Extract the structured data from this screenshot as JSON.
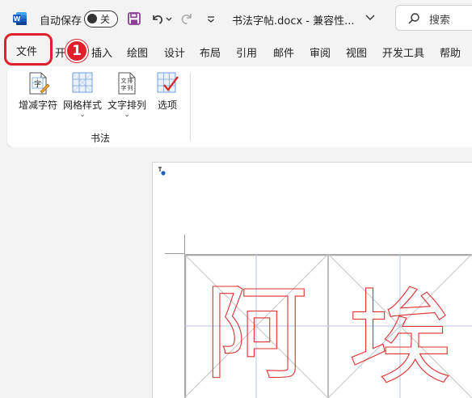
{
  "titlebar": {
    "autosave_label": "自动保存",
    "autosave_state": "关",
    "doc_title": "书法字帖.docx  -  兼容性...",
    "search_placeholder": "搜索"
  },
  "tabs": {
    "file": "文件",
    "home_partial": "开",
    "insert": "插入",
    "draw": "绘图",
    "design": "设计",
    "layout": "布局",
    "references": "引用",
    "mailings": "邮件",
    "review": "审阅",
    "view": "视图",
    "developer": "开发工具",
    "help": "帮助"
  },
  "annotation": {
    "step_number": "1",
    "color": "#e0202a"
  },
  "ribbon": {
    "group_label": "书法",
    "commands": {
      "add_remove_chars": "增减字符",
      "grid_style": "网格样式",
      "text_arrangement": "文字排列",
      "options": "选项"
    }
  },
  "document": {
    "characters": [
      "阿",
      "埃"
    ],
    "char_color": "#e03030",
    "grid_color": "#b9c6e0"
  }
}
